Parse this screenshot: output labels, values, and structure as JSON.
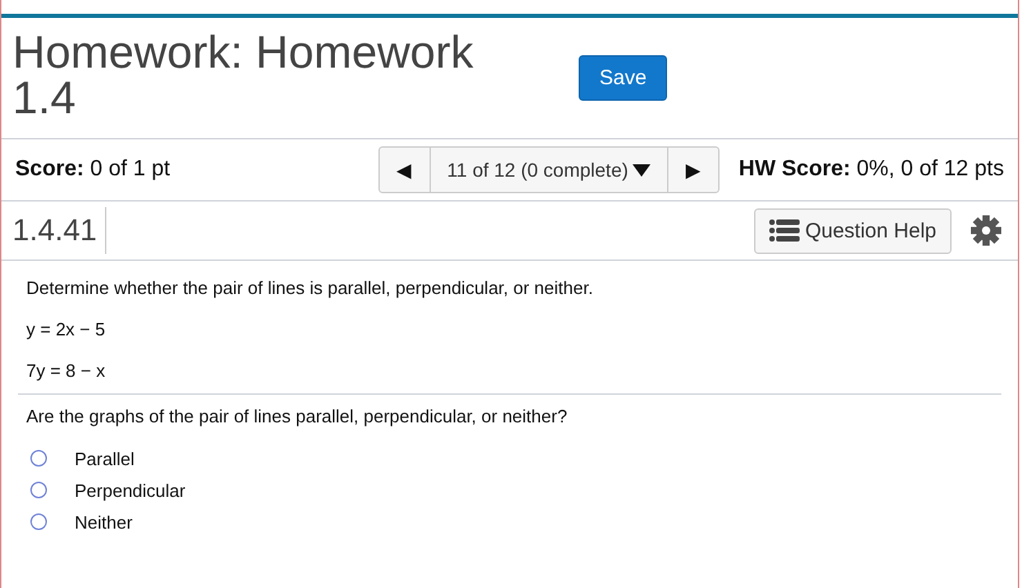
{
  "header": {
    "title": "Homework: Homework 1.4",
    "save_button": "Save"
  },
  "score_bar": {
    "score_label": "Score:",
    "score_value": "0 of 1 pt",
    "prev": "◀",
    "question_picker": "11 of 12 (0 complete)",
    "next": "▶",
    "hw_score_label": "HW Score:",
    "hw_score_value": "0%, 0 of 12 pts"
  },
  "question_bar": {
    "number": "1.4.41",
    "help_button": "Question Help"
  },
  "question": {
    "prompt": "Determine whether the pair of lines is parallel, perpendicular, or neither.",
    "equations": [
      "y = 2x − 5",
      "7y = 8 − x"
    ],
    "ask": "Are the graphs of the pair of lines parallel, perpendicular, or neither?",
    "options": [
      {
        "label": "Parallel",
        "selected": false
      },
      {
        "label": "Perpendicular",
        "selected": false
      },
      {
        "label": "Neither",
        "selected": false
      }
    ]
  }
}
